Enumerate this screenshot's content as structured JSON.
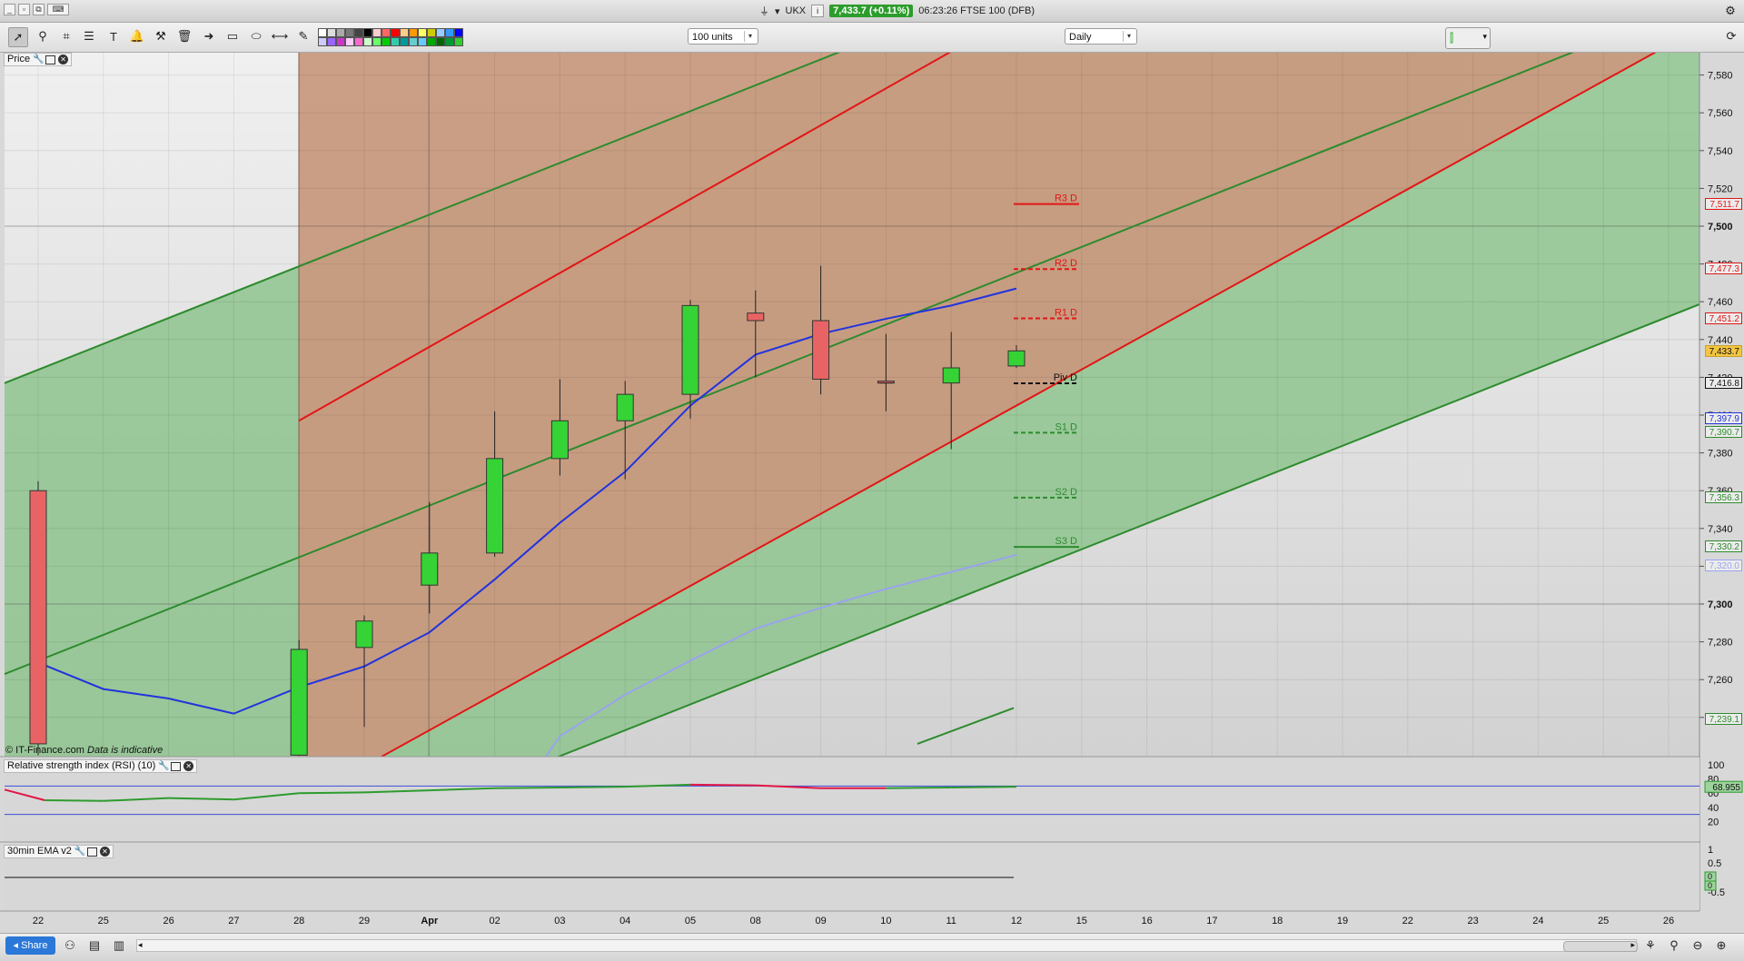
{
  "window": {
    "symbol": "UKX",
    "price": "7,433.7 (+0.11%)",
    "time_desc": "06:23:26 FTSE 100 (DFB)"
  },
  "toolbar": {
    "tools": [
      "pointer-icon",
      "zoom-icon",
      "chart-tool-icon",
      "text-icon",
      "fib-icon",
      "alarm-icon",
      "hammer-icon",
      "trash-icon",
      "arrow-icon",
      "rectangle-icon",
      "ellipse-icon",
      "segment-icon",
      "pencil-icon"
    ],
    "units_select": "100 units",
    "interval_select": "Daily",
    "palette": [
      "#ffffff",
      "#dddddd",
      "#aaaaaa",
      "#777777",
      "#444444",
      "#000000",
      "#ffcccc",
      "#ff6666",
      "#ff0000",
      "#ffcc88",
      "#ff9900",
      "#ffff66",
      "#cccc00",
      "#99ccff",
      "#3399ff",
      "#0000ff",
      "#ccccff",
      "#9966ff",
      "#cc33cc",
      "#ffccff",
      "#ff66cc",
      "#ccffcc",
      "#66ff66",
      "#00cc00",
      "#33ccaa",
      "#009999",
      "#66cccc",
      "#66ccff",
      "#00aa00",
      "#006600",
      "#009933",
      "#33cc33"
    ]
  },
  "panels": {
    "price_label": "Price",
    "rsi_label": "Relative strength index (RSI) (10)",
    "ema_label": "30min EMA v2"
  },
  "credit": {
    "source": "© IT-Finance.com",
    "note": "Data is indicative"
  },
  "colors": {
    "up_candle": "#35d335",
    "down_candle": "#e86464",
    "green_channel": "#2e8b2e",
    "red_channel": "#e21616",
    "sma_dark": "#2233dd",
    "sma_light": "#9aa3ee",
    "green_zone": "#8ec48e",
    "red_zone": "#c89a80"
  },
  "chart_data": {
    "type": "candlestick",
    "x_labels": [
      "22",
      "25",
      "26",
      "27",
      "28",
      "29",
      "Apr",
      "02",
      "03",
      "04",
      "05",
      "08",
      "09",
      "10",
      "11",
      "12",
      "15",
      "16",
      "17",
      "18",
      "19",
      "22",
      "23",
      "24",
      "25",
      "26"
    ],
    "y_ticks": [
      7580,
      7560,
      7540,
      7520,
      7500,
      7480,
      7460,
      7440,
      7420,
      7400,
      7380,
      7360,
      7340,
      7320,
      7300,
      7280,
      7260,
      7240
    ],
    "y_tick_labels": [
      "7,580",
      "7,560",
      "7,540",
      "7,520",
      "7,500",
      "7,480",
      "7,460",
      "7,440",
      "7,420",
      "7,400",
      "7,380",
      "7,360",
      "7,340",
      "7,320",
      "7,300",
      "7,280",
      "7,260",
      "7,240"
    ],
    "y_range": [
      7226,
      7590
    ],
    "candles": [
      {
        "x": "22",
        "o": 7360,
        "h": 7365,
        "l": 7220,
        "c": 7226
      },
      {
        "x": "28",
        "o": 7220,
        "h": 7281,
        "l": 7220,
        "c": 7276
      },
      {
        "x": "29",
        "o": 7277,
        "h": 7294,
        "l": 7235,
        "c": 7291
      },
      {
        "x": "Apr",
        "o": 7310,
        "h": 7354,
        "l": 7295,
        "c": 7327
      },
      {
        "x": "02",
        "o": 7327,
        "h": 7402,
        "l": 7325,
        "c": 7377
      },
      {
        "x": "03",
        "o": 7377,
        "h": 7419,
        "l": 7368,
        "c": 7397
      },
      {
        "x": "04",
        "o": 7397,
        "h": 7418,
        "l": 7366,
        "c": 7411
      },
      {
        "x": "05",
        "o": 7411,
        "h": 7461,
        "l": 7398,
        "c": 7458
      },
      {
        "x": "08",
        "o": 7454,
        "h": 7466,
        "l": 7420,
        "c": 7450
      },
      {
        "x": "09",
        "o": 7450,
        "h": 7479,
        "l": 7411,
        "c": 7419
      },
      {
        "x": "10",
        "o": 7418,
        "h": 7443,
        "l": 7402,
        "c": 7417
      },
      {
        "x": "11",
        "o": 7417,
        "h": 7444,
        "l": 7382,
        "c": 7425
      },
      {
        "x": "12",
        "o": 7426,
        "h": 7437,
        "l": 7425,
        "c": 7434
      }
    ],
    "pivots": [
      {
        "name": "R3 D",
        "value": 7511.7,
        "color": "#e21616",
        "style": "solid"
      },
      {
        "name": "R2 D",
        "value": 7477.3,
        "color": "#e21616",
        "style": "dashed"
      },
      {
        "name": "R1 D",
        "value": 7451.2,
        "color": "#e21616",
        "style": "dashed"
      },
      {
        "name": "Piv D",
        "value": 7416.8,
        "color": "#111111",
        "style": "dashed"
      },
      {
        "name": "S1 D",
        "value": 7390.7,
        "color": "#2e8b2e",
        "style": "dashed"
      },
      {
        "name": "S2 D",
        "value": 7356.3,
        "color": "#2e8b2e",
        "style": "dashed"
      },
      {
        "name": "S3 D",
        "value": 7330.2,
        "color": "#2e8b2e",
        "style": "solid"
      }
    ],
    "price_boxes": [
      {
        "label": "7,511.7",
        "value": 7511.7,
        "color": "#e21616"
      },
      {
        "label": "7,477.3",
        "value": 7477.3,
        "color": "#e21616"
      },
      {
        "label": "7,451.2",
        "value": 7451.2,
        "color": "#e21616"
      },
      {
        "label": "7,433.7",
        "value": 7433.7,
        "color": "#111111",
        "bg": "#f4c542"
      },
      {
        "label": "7,416.8",
        "value": 7416.8,
        "color": "#111111"
      },
      {
        "label": "7,397.9",
        "value": 7397.9,
        "color": "#2233dd"
      },
      {
        "label": "7,390.7",
        "value": 7390.7,
        "color": "#2e8b2e"
      },
      {
        "label": "7,356.3",
        "value": 7356.3,
        "color": "#2e8b2e"
      },
      {
        "label": "7,330.2",
        "value": 7330.2,
        "color": "#2e8b2e"
      },
      {
        "label": "7,320.0",
        "value": 7320.0,
        "color": "#9aa3ee"
      },
      {
        "label": "7,239.1",
        "value": 7239.1,
        "color": "#2e8b2e"
      }
    ],
    "sma_dark": [
      {
        "x": "22",
        "y": 7269
      },
      {
        "x": "25",
        "y": 7255
      },
      {
        "x": "26",
        "y": 7250
      },
      {
        "x": "27",
        "y": 7242
      },
      {
        "x": "28",
        "y": 7256
      },
      {
        "x": "29",
        "y": 7267
      },
      {
        "x": "Apr",
        "y": 7285
      },
      {
        "x": "02",
        "y": 7313
      },
      {
        "x": "03",
        "y": 7343
      },
      {
        "x": "04",
        "y": 7370
      },
      {
        "x": "05",
        "y": 7405
      },
      {
        "x": "08",
        "y": 7432
      },
      {
        "x": "09",
        "y": 7443
      },
      {
        "x": "10",
        "y": 7451
      },
      {
        "x": "11",
        "y": 7458
      },
      {
        "x": "12",
        "y": 7467
      }
    ],
    "sma_light": [
      {
        "x": "02",
        "y": 7180
      },
      {
        "x": "03",
        "y": 7230
      },
      {
        "x": "04",
        "y": 7252
      },
      {
        "x": "05",
        "y": 7270
      },
      {
        "x": "08",
        "y": 7287
      },
      {
        "x": "09",
        "y": 7298
      },
      {
        "x": "10",
        "y": 7308
      },
      {
        "x": "11",
        "y": 7317
      },
      {
        "x": "12",
        "y": 7326
      }
    ],
    "rsi": {
      "label": "68.955",
      "y_ticks": [
        "100",
        "80",
        "60",
        "40",
        "20"
      ],
      "values": [
        {
          "x": "22",
          "y": 65
        },
        {
          "x": "22b",
          "y": 50
        },
        {
          "x": "25",
          "y": 49
        },
        {
          "x": "26",
          "y": 53
        },
        {
          "x": "27",
          "y": 51
        },
        {
          "x": "28",
          "y": 60
        },
        {
          "x": "29",
          "y": 61
        },
        {
          "x": "Apr",
          "y": 64
        },
        {
          "x": "02",
          "y": 67
        },
        {
          "x": "03",
          "y": 68
        },
        {
          "x": "04",
          "y": 69
        },
        {
          "x": "05",
          "y": 72
        },
        {
          "x": "08",
          "y": 71
        },
        {
          "x": "09",
          "y": 67
        },
        {
          "x": "10",
          "y": 67
        },
        {
          "x": "11",
          "y": 68
        },
        {
          "x": "12",
          "y": 69
        }
      ]
    },
    "ema": {
      "y_ticks": [
        "1",
        "0.5",
        "0",
        "-0.5"
      ],
      "value_labels": [
        "0",
        "0"
      ]
    }
  }
}
